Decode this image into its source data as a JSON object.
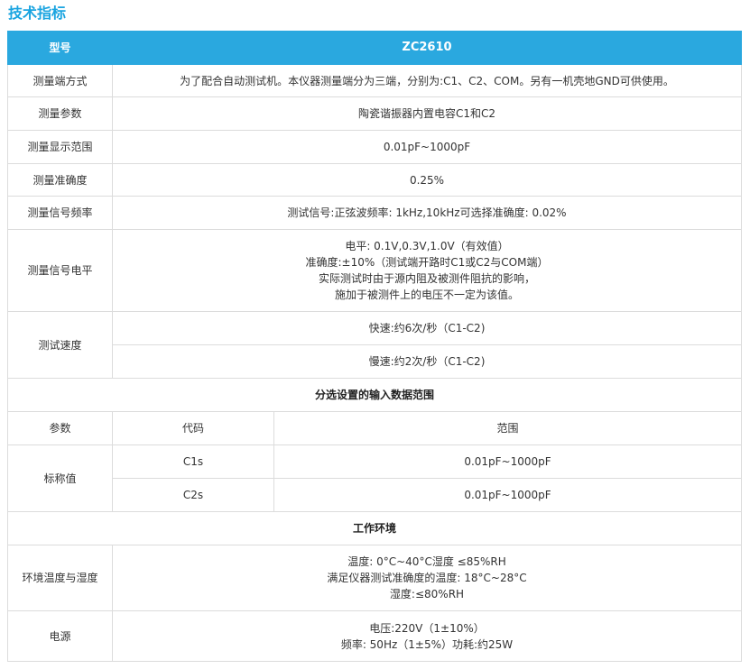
{
  "title": "技术指标",
  "header": {
    "label": "型号",
    "model": "ZC2610"
  },
  "rows": [
    {
      "label": "测量端方式",
      "value": "为了配合自动测试机。本仪器测量端分为三端，分别为:C1、C2、COM。另有一机壳地GND可供使用。"
    },
    {
      "label": "测量参数",
      "value": "陶瓷谐振器内置电容C1和C2"
    },
    {
      "label": "测量显示范围",
      "value": "0.01pF~1000pF"
    },
    {
      "label": "测量准确度",
      "value": "0.25%"
    },
    {
      "label": "测量信号频率",
      "value": "测试信号:正弦波频率: 1kHz,10kHz可选择准确度: 0.02%"
    },
    {
      "label": "测量信号电平",
      "lines": [
        "电平: 0.1V,0.3V,1.0V（有效值）",
        "准确度:±10%（测试端开路时C1或C2与COM端）",
        "实际测试时由于源内阻及被测件阻抗的影响，",
        "施加于被测件上的电压不一定为该值。"
      ]
    },
    {
      "label": "测试速度",
      "values": [
        "快速:约6次/秒（C1-C2)",
        "慢速:约2次/秒（C1-C2)"
      ]
    }
  ],
  "section1": {
    "title": "分选设置的输入数据范围",
    "columns": [
      "参数",
      "代码",
      "范围"
    ],
    "label": "标称值",
    "items": [
      {
        "code": "C1s",
        "range": "0.01pF~1000pF"
      },
      {
        "code": "C2s",
        "range": "0.01pF~1000pF"
      }
    ]
  },
  "section2": {
    "title": "工作环境",
    "rows": [
      {
        "label": "环境温度与湿度",
        "lines": [
          "温度: 0°C~40°C湿度 ≤85%RH",
          "满足仪器测试准确度的温度: 18°C~28°C",
          "湿度:≤80%RH"
        ]
      },
      {
        "label": "电源",
        "lines": [
          "电压:220V（1±10%）",
          "频率: 50Hz（1±5%）功耗:约25W"
        ]
      }
    ]
  },
  "colors": {
    "accent": "#2aa8df",
    "title": "#1aa4e0",
    "border": "#dcdcdc"
  }
}
